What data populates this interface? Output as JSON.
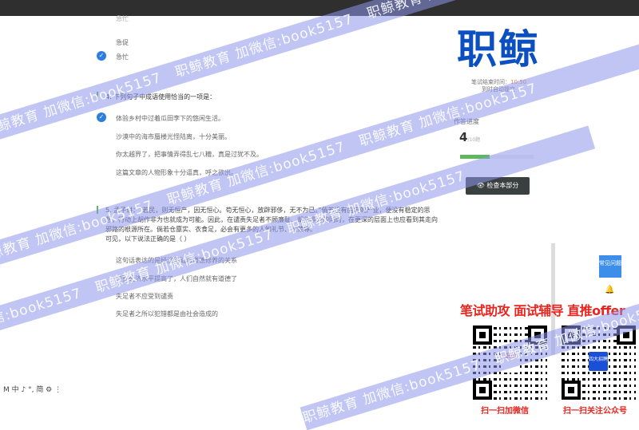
{
  "watermark": "职鲸教育 加微信:book5157",
  "questions": {
    "q3": {
      "options": [
        "急忙",
        "急促",
        "急忙"
      ],
      "selected": 2
    },
    "q4": {
      "number": "4.",
      "title": "下列句子中成语使用恰当的一项是：",
      "options": [
        "体验乡村中过着瓜田李下的悠闲生活。",
        "沙漠中的海市蜃楼光怪陆离，十分美丽。",
        "你太越界了，把事情弄得乱七八糟，真是过犹不及。",
        "这篇文章的人物形象十分逼真，呼之欲出。"
      ],
      "selected": 0
    },
    "q5": {
      "number": "5.",
      "text": "孟子讲：“若民，则无恒产，因无恒心。苟无恒心，放辟邪侈，无不为已。”倘若没有固定的产业，便没有稳定的思想，行动上胡作非为也就成为可能。因此，在谴责失足者不顾廉耻、胡作非为的同时，在更深的层面上也应看到其走向邪路的根源所在。倘若仓廪实、衣食足，必会有更多的人知礼节、识荣辱。",
      "prompt": "可见，以下说法正确的是（ ）",
      "options": [
        "这句话表达的是经济基础与道德修养的关系",
        "只要经济水平提高了，人们自然就有道德了",
        "失足者不应受到谴责",
        "失足者之所以犯错都是由社会造成的"
      ]
    }
  },
  "sidebar": {
    "logo": "职鲸",
    "end_time_label": "笔试结束时间：",
    "end_time": "10:50",
    "auto_submit": "到时自动提交",
    "progress_label": "作答进度",
    "progress_done": "4",
    "progress_total": "/10题",
    "progress_percent": 40,
    "check_button": "检查本部分",
    "faq_button": "常见问题"
  },
  "promo": {
    "headline": "笔试助攻  面试辅导  直推offer",
    "qr1_caption": "扫一扫加微信",
    "qr2_caption": "扫一扫关注公众号",
    "qr1_badge": "职鲸",
    "qr2_badge": "四大招聘"
  },
  "ime_bar": "M 中 ♪ °, 简 ⚙ ⋮",
  "colors": {
    "accent": "#2e7de0",
    "progress": "#5cb85c",
    "promo": "#e8251f",
    "logo": "#0b4fc0"
  }
}
